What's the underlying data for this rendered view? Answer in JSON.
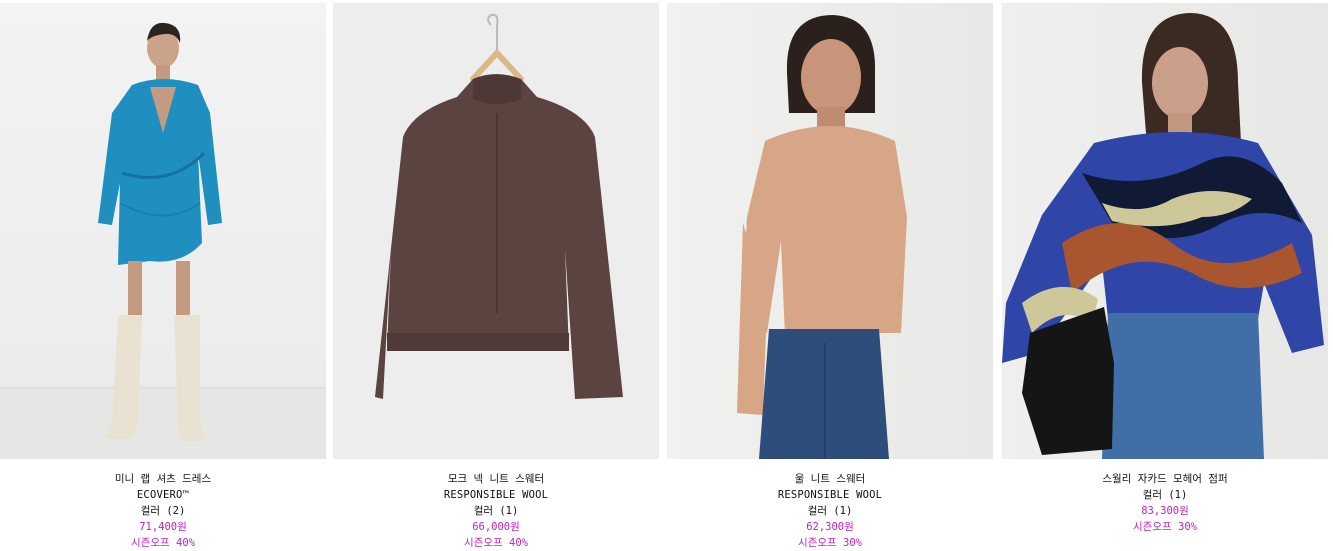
{
  "products": [
    {
      "name": "미니 랩 셔츠 드레스",
      "tag": "ECOVERO™",
      "colors": "컬러 (2)",
      "price": "71,400원",
      "discount": "시즌오프 40%",
      "image_icon": "model-blue-wrap-dress-image"
    },
    {
      "name": "모크 넥 니트 스웨터",
      "tag": "RESPONSIBLE WOOL",
      "colors": "컬러 (1)",
      "price": "66,000원",
      "discount": "시즌오프 40%",
      "image_icon": "brown-knit-sweater-on-hanger-image"
    },
    {
      "name": "울 니트 스웨터",
      "tag": "RESPONSIBLE WOOL",
      "colors": "컬러 (1)",
      "price": "62,300원",
      "discount": "시즌오프 30%",
      "image_icon": "model-beige-sweater-image"
    },
    {
      "name": "스월리 자카드 모헤어 점퍼",
      "colors": "컬러 (1)",
      "price": "83,300원",
      "discount": "시즌오프 30%",
      "image_icon": "model-swirl-mohair-jumper-image"
    }
  ],
  "colors": {
    "price": "#c023c0",
    "text": "#111111"
  }
}
